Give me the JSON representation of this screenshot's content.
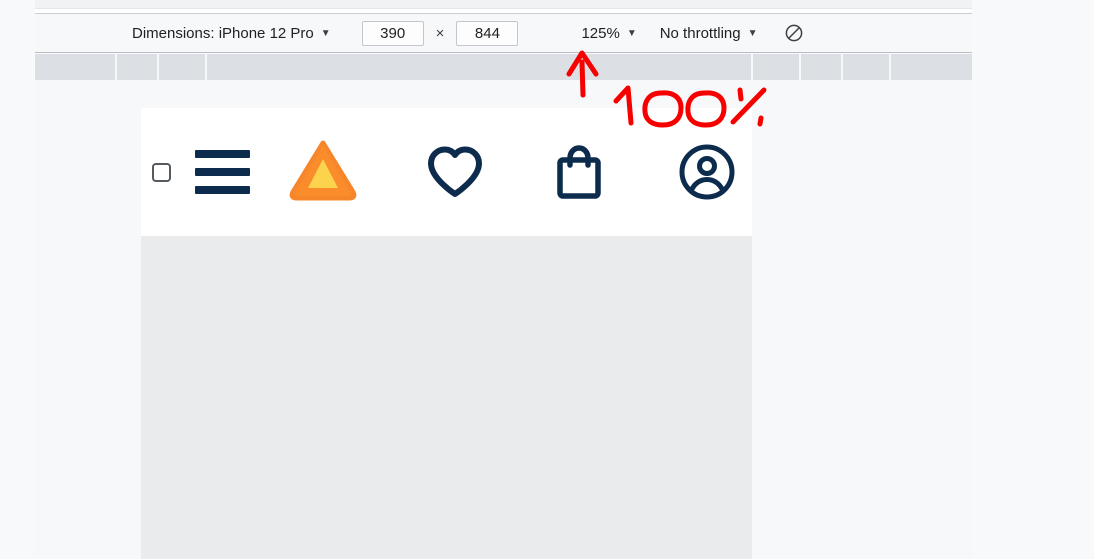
{
  "devtools": {
    "toolbar": {
      "dimensions_label": "Dimensions: iPhone 12 Pro",
      "dimensions_caret": "▼",
      "width_value": "390",
      "size_separator": "×",
      "height_value": "844",
      "zoom_value": "125%",
      "zoom_caret": "▼",
      "throttling_value": "No throttling",
      "throttling_caret": "▼",
      "rotate_icon": "rotate-device-icon"
    },
    "ruler": {
      "segment_widths": [
        82,
        42,
        48,
        546,
        48,
        42,
        48,
        81
      ]
    }
  },
  "annotation": {
    "text": "100 %",
    "color": "#f70000",
    "arrow": "up-arrow",
    "points_at": "zoom_value"
  },
  "viewport_page": {
    "header": {
      "items": [
        {
          "name": "checkbox",
          "icon": "checkbox-empty-icon"
        },
        {
          "name": "menu",
          "icon": "hamburger-menu-icon"
        },
        {
          "name": "logo",
          "icon": "triangle-logo-icon"
        },
        {
          "name": "wishlist",
          "icon": "heart-icon"
        },
        {
          "name": "cart",
          "icon": "shopping-bag-icon"
        },
        {
          "name": "account",
          "icon": "account-circle-icon"
        }
      ]
    }
  },
  "colors": {
    "brand_navy": "#0d2c4d",
    "logo_orange": "#f97316",
    "logo_orange_dark": "#f26a22",
    "logo_yellow": "#fcd34d",
    "annotation_red": "#f70000",
    "panel_bg": "#f7f8f9",
    "ruler_gray": "#dcdfe4",
    "page_body_gray": "#eaebed"
  }
}
